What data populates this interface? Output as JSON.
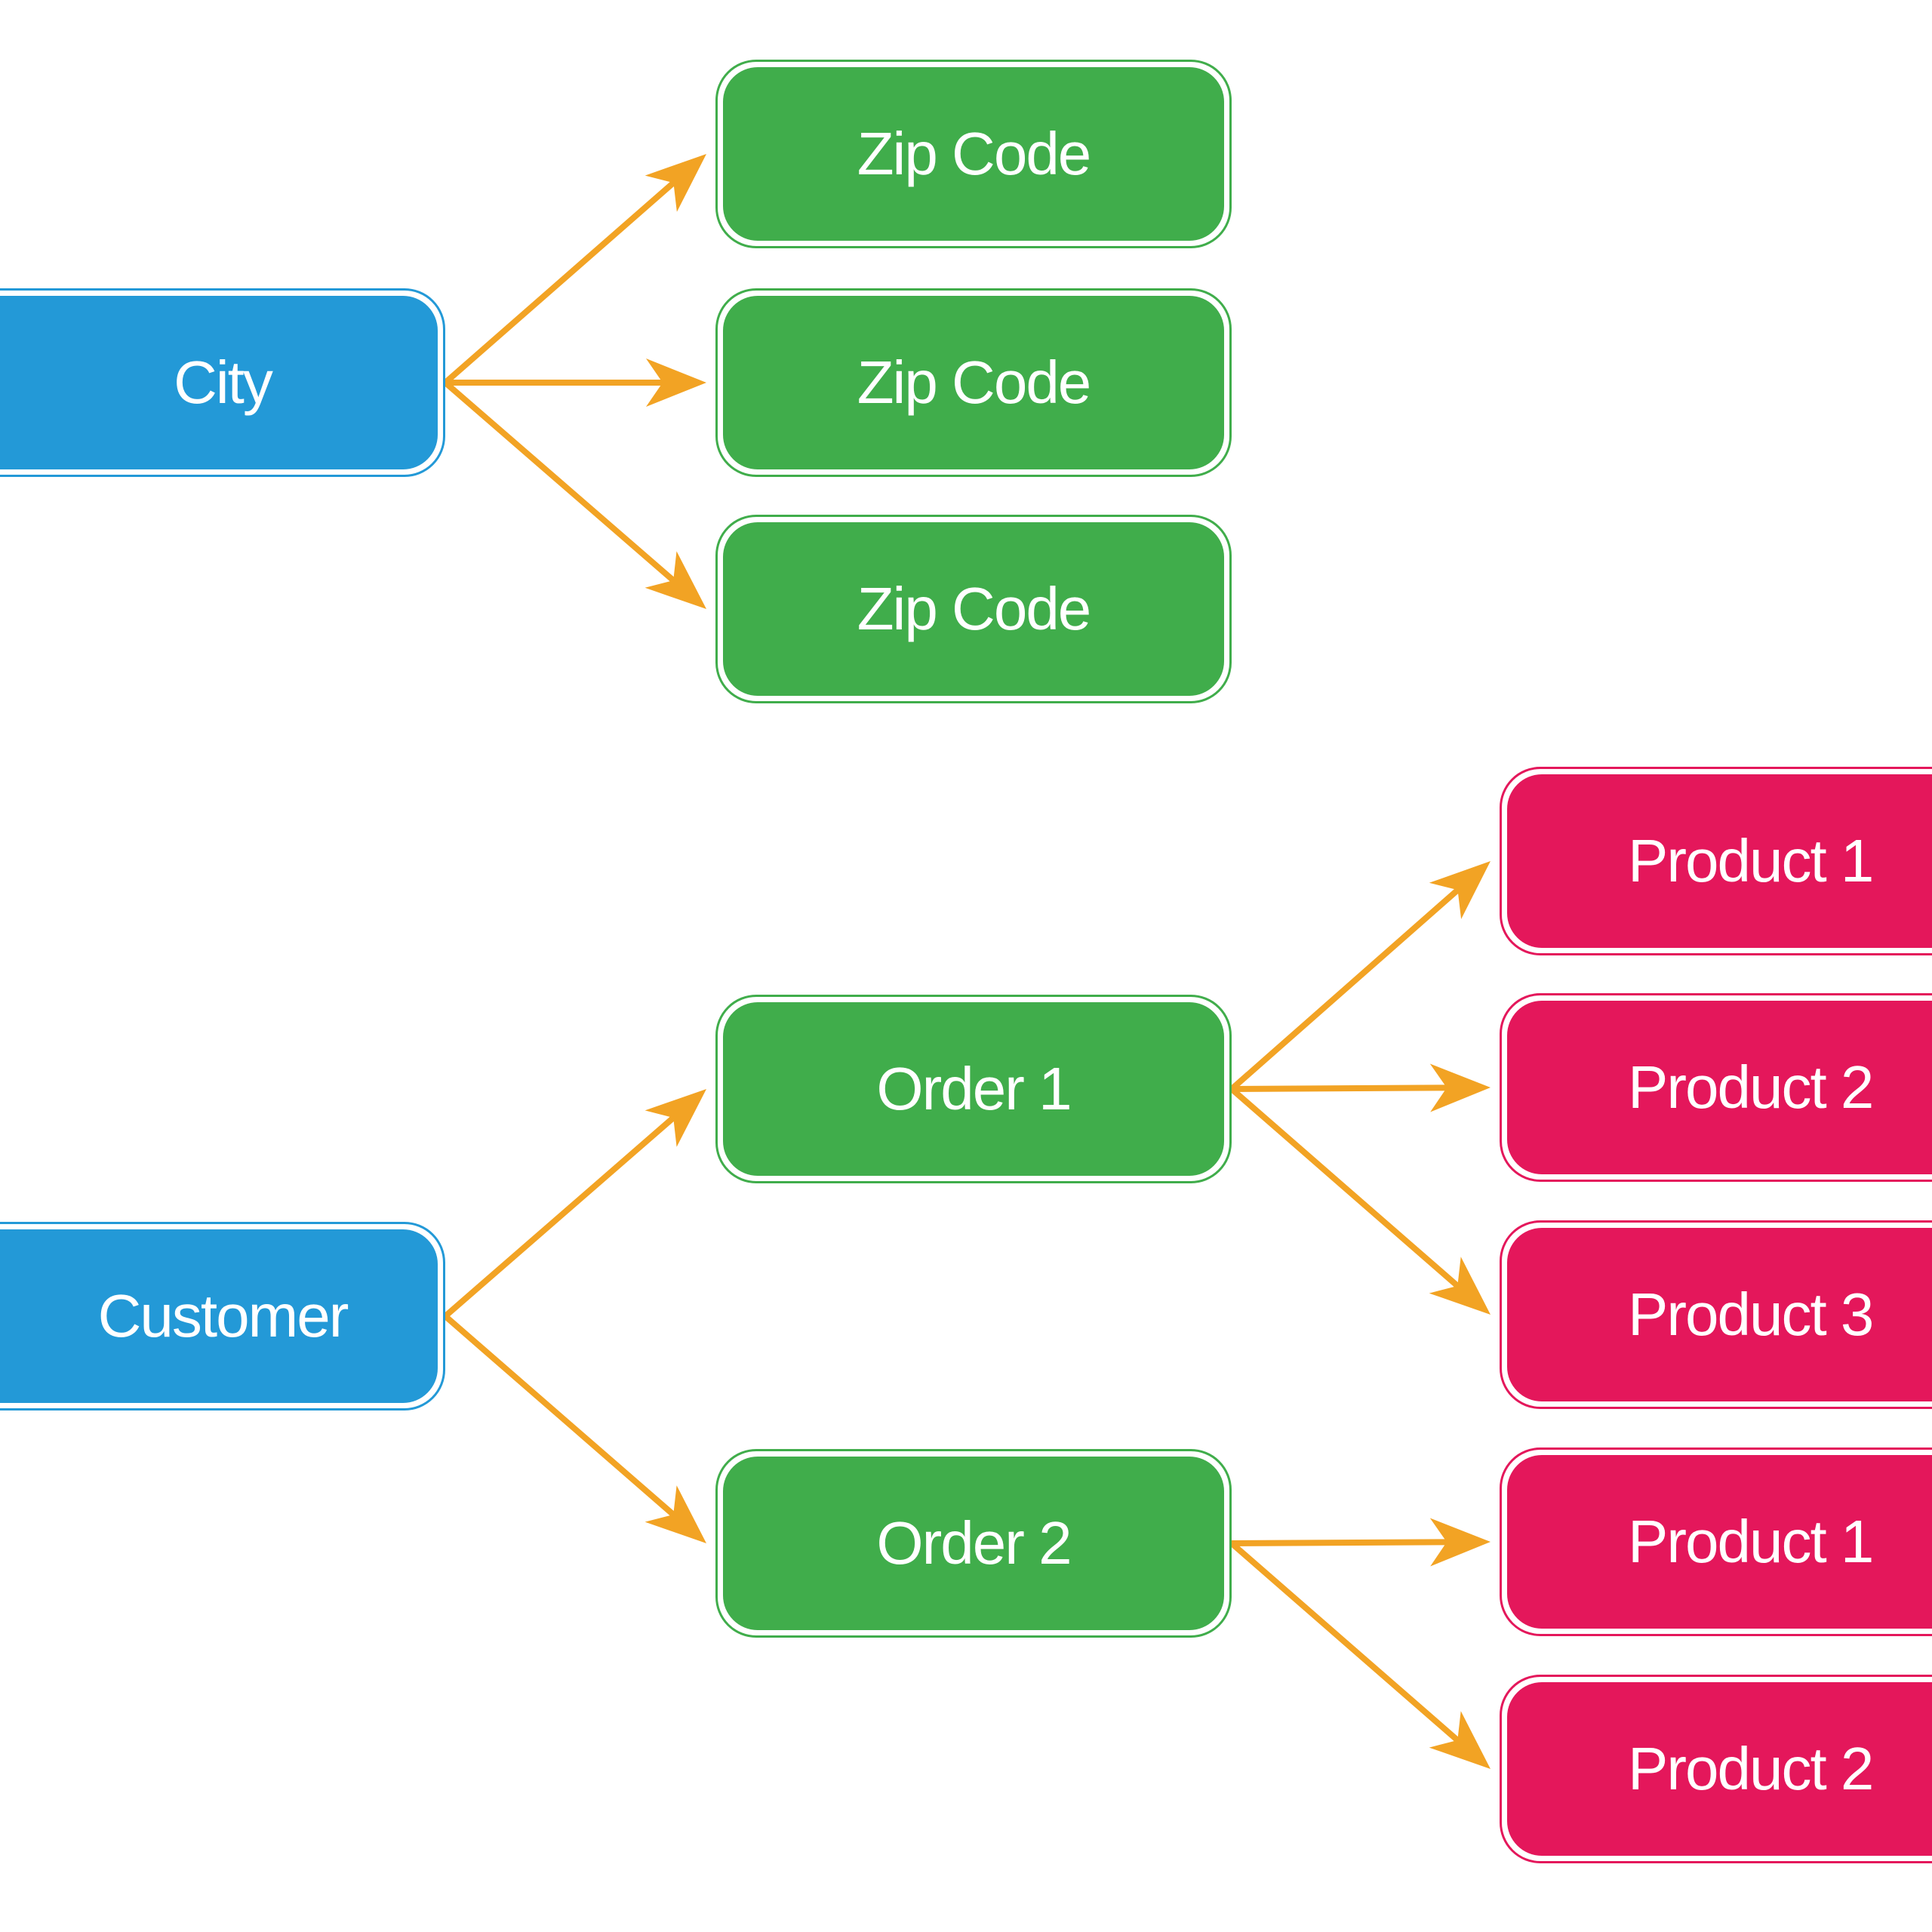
{
  "diagram": {
    "title": "",
    "colors": {
      "entity_root": "#2399d7",
      "entity_child": "#40ad4b",
      "entity_leaf": "#e4175b",
      "arrow": "#f2a324",
      "background": "#ffffff"
    },
    "groups": [
      {
        "name": "city-hierarchy",
        "root": {
          "id": "city",
          "label": "City"
        },
        "children": [
          {
            "id": "zip1",
            "label": "Zip Code"
          },
          {
            "id": "zip2",
            "label": "Zip Code"
          },
          {
            "id": "zip3",
            "label": "Zip Code"
          }
        ]
      },
      {
        "name": "customer-hierarchy",
        "root": {
          "id": "customer",
          "label": "Customer"
        },
        "children": [
          {
            "id": "order1",
            "label": "Order 1",
            "children": [
              {
                "id": "o1p1",
                "label": "Product 1"
              },
              {
                "id": "o1p2",
                "label": "Product 2"
              },
              {
                "id": "o1p3",
                "label": "Product 3"
              }
            ]
          },
          {
            "id": "order2",
            "label": "Order 2",
            "children": [
              {
                "id": "o2p1",
                "label": "Product 1"
              },
              {
                "id": "o2p2",
                "label": "Product 2"
              }
            ]
          }
        ]
      }
    ],
    "edges": [
      {
        "from": "city",
        "to": "zip1"
      },
      {
        "from": "city",
        "to": "zip2"
      },
      {
        "from": "city",
        "to": "zip3"
      },
      {
        "from": "customer",
        "to": "order1"
      },
      {
        "from": "customer",
        "to": "order2"
      },
      {
        "from": "order1",
        "to": "o1p1"
      },
      {
        "from": "order1",
        "to": "o1p2"
      },
      {
        "from": "order1",
        "to": "o1p3"
      },
      {
        "from": "order2",
        "to": "o2p1"
      },
      {
        "from": "order2",
        "to": "o2p2"
      }
    ]
  }
}
